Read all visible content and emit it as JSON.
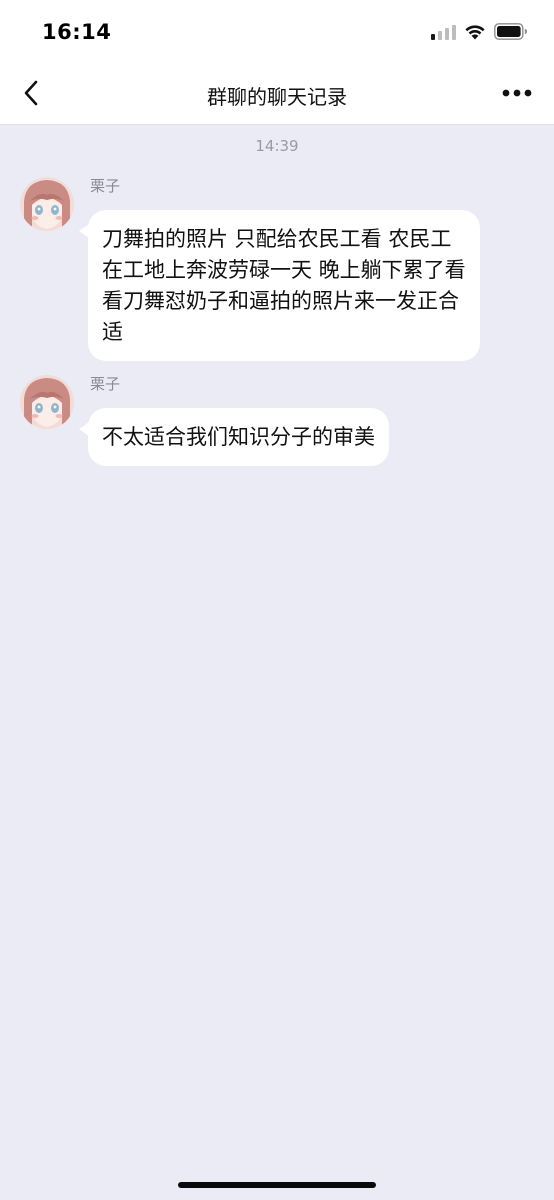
{
  "status_bar": {
    "time": "16:14",
    "icons": [
      "cellular-signal-icon",
      "wifi-icon",
      "battery-icon"
    ]
  },
  "header": {
    "title": "群聊的聊天记录",
    "back_icon": "chevron-left-icon",
    "more_icon": "more-dots-icon"
  },
  "chat": {
    "timestamp": "14:39",
    "messages": [
      {
        "sender": "栗子",
        "text": "刀舞拍的照片 只配给农民工看  农民工在工地上奔波劳碌一天 晚上躺下累了看看刀舞怼奶子和逼拍的照片来一发正合适"
      },
      {
        "sender": "栗子",
        "text": "不太适合我们知识分子的审美"
      }
    ]
  },
  "colors": {
    "background": "#ebebf5",
    "bar": "#ffffff",
    "bubble": "#ffffff",
    "meta_text": "#9a9aa4"
  }
}
